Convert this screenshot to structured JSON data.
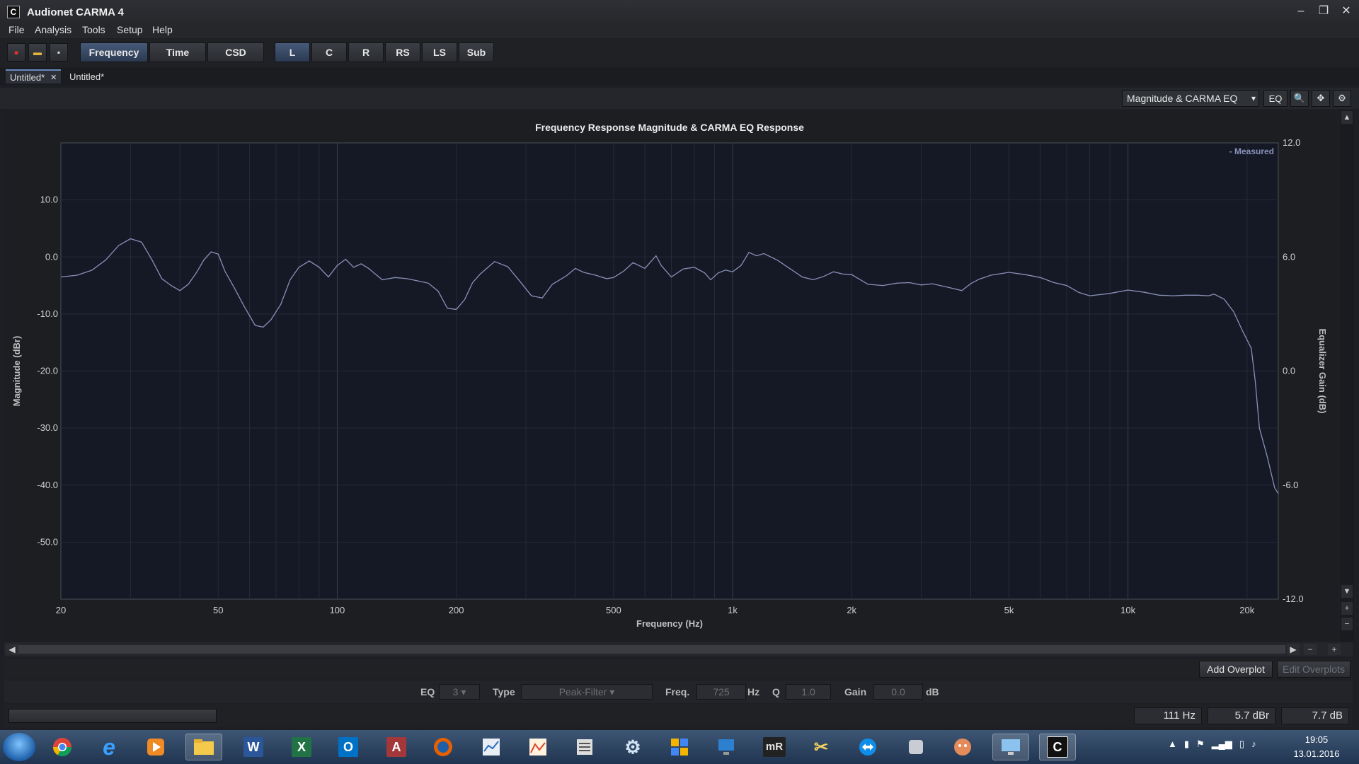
{
  "window": {
    "title": "Audionet CARMA 4",
    "icon": "C",
    "minimize": "‒",
    "maximize": "❐",
    "close": "✕"
  },
  "menu": [
    "File",
    "Analysis",
    "Tools",
    "Setup",
    "Help"
  ],
  "toolbar": {
    "views": [
      "Frequency",
      "Time",
      "CSD"
    ],
    "channels": [
      "L",
      "C",
      "R",
      "RS",
      "LS",
      "Sub"
    ],
    "record_icon": "●",
    "open_icon": "▬",
    "save_icon": "▪"
  },
  "tabs": [
    {
      "label": "Untitled*",
      "close": "✕"
    },
    {
      "label": "Untitled*"
    }
  ],
  "plot_toolbar": {
    "view_select": "Magnitude & CARMA EQ",
    "eq_label": "EQ",
    "zoom_icon": "🔍",
    "pan_icon": "✥",
    "settings_icon": "⚙"
  },
  "chart_data": {
    "type": "line",
    "title": "Frequency Response Magnitude & CARMA EQ Response",
    "xlabel": "Frequency (Hz)",
    "ylabel": "Magnitude (dBr)",
    "y2label": "Equalizer Gain (dB)",
    "xscale": "log",
    "xlim": [
      20,
      24000
    ],
    "ylim": [
      -60,
      20
    ],
    "y2lim": [
      -12,
      12
    ],
    "x_ticks": [
      20,
      50,
      100,
      200,
      500,
      1000,
      2000,
      5000,
      10000,
      20000
    ],
    "x_tick_labels": [
      "20",
      "50",
      "100",
      "200",
      "500",
      "1k",
      "2k",
      "5k",
      "10k",
      "20k"
    ],
    "y_ticks": [
      10,
      0,
      -10,
      -20,
      -30,
      -40,
      -50
    ],
    "y_tick_labels": [
      "10.0",
      "0.0",
      "-10.0",
      "-20.0",
      "-30.0",
      "-40.0",
      "-50.0"
    ],
    "y2_ticks": [
      12,
      6,
      0,
      -6,
      -12
    ],
    "y2_tick_labels": [
      "12.0",
      "6.0",
      "0.0",
      "-6.0",
      "-12.0"
    ],
    "legend": "top-right",
    "grid": true,
    "series": [
      {
        "name": "Measured",
        "color": "#8a90b8",
        "points": [
          [
            20,
            -3.5
          ],
          [
            22,
            -3.2
          ],
          [
            24,
            -2.3
          ],
          [
            26,
            -0.5
          ],
          [
            28,
            2.0
          ],
          [
            30,
            3.2
          ],
          [
            32,
            2.6
          ],
          [
            34,
            -0.5
          ],
          [
            36,
            -3.8
          ],
          [
            38,
            -5.0
          ],
          [
            40,
            -5.9
          ],
          [
            42,
            -4.8
          ],
          [
            44,
            -2.8
          ],
          [
            46,
            -0.5
          ],
          [
            48,
            0.9
          ],
          [
            50,
            0.5
          ],
          [
            52,
            -2.5
          ],
          [
            55,
            -5.5
          ],
          [
            58,
            -8.5
          ],
          [
            62,
            -12.0
          ],
          [
            65,
            -12.3
          ],
          [
            68,
            -11.0
          ],
          [
            72,
            -8.3
          ],
          [
            76,
            -4.0
          ],
          [
            80,
            -1.8
          ],
          [
            85,
            -0.7
          ],
          [
            90,
            -1.8
          ],
          [
            95,
            -3.5
          ],
          [
            100,
            -1.5
          ],
          [
            105,
            -0.4
          ],
          [
            110,
            -1.8
          ],
          [
            115,
            -1.2
          ],
          [
            120,
            -2.0
          ],
          [
            130,
            -4.0
          ],
          [
            140,
            -3.6
          ],
          [
            150,
            -3.8
          ],
          [
            160,
            -4.2
          ],
          [
            170,
            -4.6
          ],
          [
            180,
            -6.0
          ],
          [
            190,
            -9.0
          ],
          [
            200,
            -9.2
          ],
          [
            210,
            -7.5
          ],
          [
            220,
            -4.5
          ],
          [
            230,
            -3.0
          ],
          [
            250,
            -0.8
          ],
          [
            270,
            -1.7
          ],
          [
            290,
            -4.3
          ],
          [
            310,
            -6.8
          ],
          [
            330,
            -7.2
          ],
          [
            350,
            -4.8
          ],
          [
            380,
            -3.3
          ],
          [
            400,
            -2.0
          ],
          [
            420,
            -2.7
          ],
          [
            450,
            -3.2
          ],
          [
            480,
            -3.8
          ],
          [
            500,
            -3.6
          ],
          [
            530,
            -2.5
          ],
          [
            560,
            -1.0
          ],
          [
            600,
            -2.0
          ],
          [
            640,
            0.2
          ],
          [
            660,
            -1.5
          ],
          [
            700,
            -3.5
          ],
          [
            750,
            -2.1
          ],
          [
            800,
            -1.8
          ],
          [
            850,
            -2.8
          ],
          [
            880,
            -4.0
          ],
          [
            920,
            -2.8
          ],
          [
            960,
            -2.3
          ],
          [
            1000,
            -2.6
          ],
          [
            1050,
            -1.5
          ],
          [
            1100,
            0.8
          ],
          [
            1150,
            0.2
          ],
          [
            1200,
            0.6
          ],
          [
            1300,
            -0.6
          ],
          [
            1400,
            -2.1
          ],
          [
            1500,
            -3.5
          ],
          [
            1600,
            -4.0
          ],
          [
            1700,
            -3.4
          ],
          [
            1800,
            -2.6
          ],
          [
            1900,
            -3.0
          ],
          [
            2000,
            -3.1
          ],
          [
            2200,
            -4.8
          ],
          [
            2400,
            -5.0
          ],
          [
            2600,
            -4.6
          ],
          [
            2800,
            -4.5
          ],
          [
            3000,
            -4.9
          ],
          [
            3200,
            -4.7
          ],
          [
            3500,
            -5.3
          ],
          [
            3800,
            -5.9
          ],
          [
            4000,
            -4.7
          ],
          [
            4200,
            -3.9
          ],
          [
            4500,
            -3.2
          ],
          [
            5000,
            -2.7
          ],
          [
            5500,
            -3.1
          ],
          [
            6000,
            -3.6
          ],
          [
            6500,
            -4.5
          ],
          [
            7000,
            -5.0
          ],
          [
            7500,
            -6.2
          ],
          [
            8000,
            -6.8
          ],
          [
            9000,
            -6.4
          ],
          [
            10000,
            -5.8
          ],
          [
            11000,
            -6.2
          ],
          [
            12000,
            -6.7
          ],
          [
            13000,
            -6.8
          ],
          [
            14000,
            -6.7
          ],
          [
            15000,
            -6.7
          ],
          [
            16000,
            -6.8
          ],
          [
            16500,
            -6.5
          ],
          [
            17500,
            -7.4
          ],
          [
            18500,
            -9.6
          ],
          [
            19500,
            -13.0
          ],
          [
            20500,
            -16.0
          ],
          [
            21000,
            -22.0
          ],
          [
            21500,
            -30.0
          ],
          [
            22500,
            -35.0
          ],
          [
            23500,
            -40.5
          ],
          [
            24000,
            -41.5
          ]
        ]
      }
    ]
  },
  "controls": {
    "add_overplot": "Add Overplot",
    "edit_overplots": "Edit Overplots",
    "scroll_left": "◀",
    "scroll_right": "▶",
    "zoom_minus": "−",
    "zoom_plus": "+",
    "vscroll_up": "▲",
    "vscroll_down": "▼"
  },
  "eq": {
    "eq_label": "EQ",
    "eq_value": "3",
    "type_label": "Type",
    "type_value": "Peak-Filter",
    "freq_label": "Freq.",
    "freq_value": "725",
    "freq_unit": "Hz",
    "q_label": "Q",
    "q_value": "1.0",
    "gain_label": "Gain",
    "gain_value": "0.0",
    "gain_unit": "dB"
  },
  "status": {
    "freq": "111 Hz",
    "mag": "5.7 dBr",
    "gain": "7.7 dB"
  },
  "taskbar": {
    "clock_time": "19:05",
    "clock_date": "13.01.2016"
  }
}
